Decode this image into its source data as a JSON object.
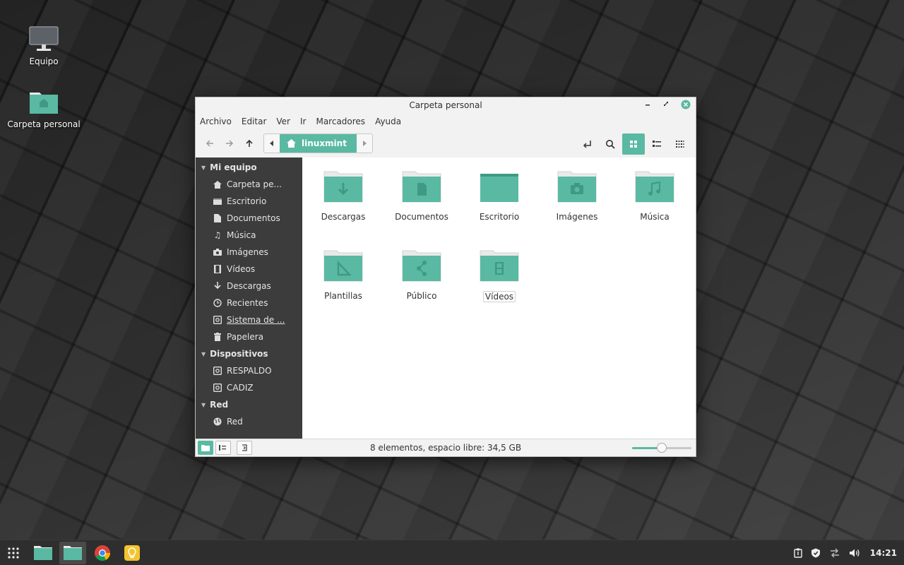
{
  "desktop": {
    "icons": [
      {
        "label": "Equipo"
      },
      {
        "label": "Carpeta personal"
      }
    ]
  },
  "window": {
    "title": "Carpeta personal",
    "menu": [
      "Archivo",
      "Editar",
      "Ver",
      "Ir",
      "Marcadores",
      "Ayuda"
    ],
    "path": {
      "crumb": "linuxmint"
    },
    "sidebar": {
      "sections": [
        {
          "title": "Mi equipo",
          "items": [
            {
              "label": "Carpeta pe...",
              "icon": "home-icon"
            },
            {
              "label": "Escritorio",
              "icon": "desktop-icon"
            },
            {
              "label": "Documentos",
              "icon": "document-icon"
            },
            {
              "label": "Música",
              "icon": "music-icon"
            },
            {
              "label": "Imágenes",
              "icon": "camera-icon"
            },
            {
              "label": "Vídeos",
              "icon": "film-icon"
            },
            {
              "label": "Descargas",
              "icon": "download-icon"
            },
            {
              "label": "Recientes",
              "icon": "clock-icon"
            },
            {
              "label": "Sistema de ...",
              "icon": "drive-icon"
            },
            {
              "label": "Papelera",
              "icon": "trash-icon"
            }
          ]
        },
        {
          "title": "Dispositivos",
          "items": [
            {
              "label": "RESPALDO",
              "icon": "drive-icon"
            },
            {
              "label": "CADIZ",
              "icon": "drive-icon"
            }
          ]
        },
        {
          "title": "Red",
          "items": [
            {
              "label": "Red",
              "icon": "globe-icon"
            }
          ]
        }
      ]
    },
    "files": [
      {
        "label": "Descargas",
        "emblem": "download"
      },
      {
        "label": "Documentos",
        "emblem": "document"
      },
      {
        "label": "Escritorio",
        "emblem": "desktop"
      },
      {
        "label": "Imágenes",
        "emblem": "camera"
      },
      {
        "label": "Música",
        "emblem": "music"
      },
      {
        "label": "Plantillas",
        "emblem": "template"
      },
      {
        "label": "Público",
        "emblem": "share"
      },
      {
        "label": "Vídeos",
        "emblem": "film",
        "selected": true
      }
    ],
    "status": {
      "text": "8 elementos, espacio libre: 34,5 GB",
      "zoom_level": 0.5
    }
  },
  "taskbar": {
    "apps": [
      "menu-grid",
      "files",
      "files-active",
      "chrome",
      "bulb"
    ],
    "clock": "14:21"
  },
  "colors": {
    "accent": "#5ab9a2",
    "sidebar_bg": "#3c3c3c"
  }
}
